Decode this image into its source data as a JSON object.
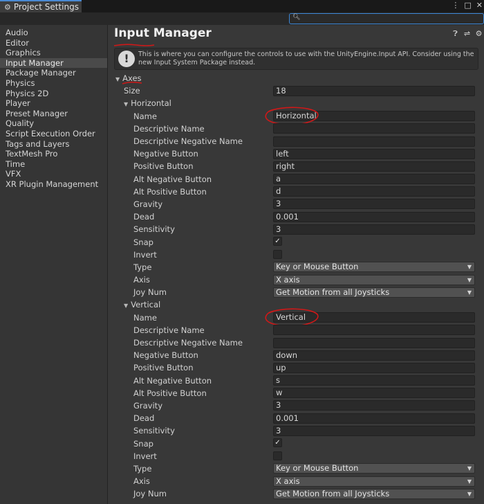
{
  "window": {
    "tab_label": "Project Settings",
    "tab_icon": "gear-icon",
    "accent": "#3b86d6"
  },
  "sidebar": {
    "items": [
      {
        "label": "Audio"
      },
      {
        "label": "Editor"
      },
      {
        "label": "Graphics"
      },
      {
        "label": "Input Manager",
        "active": true
      },
      {
        "label": "Package Manager"
      },
      {
        "label": "Physics"
      },
      {
        "label": "Physics 2D"
      },
      {
        "label": "Player"
      },
      {
        "label": "Preset Manager"
      },
      {
        "label": "Quality"
      },
      {
        "label": "Script Execution Order"
      },
      {
        "label": "Tags and Layers"
      },
      {
        "label": "TextMesh Pro"
      },
      {
        "label": "Time"
      },
      {
        "label": "VFX"
      },
      {
        "label": "XR Plugin Management"
      }
    ]
  },
  "main": {
    "title": "Input Manager",
    "help_text": "This is where you can configure the controls to use with the UnityEngine.Input API. Consider using the new Input System Package instead.",
    "axes_label": "Axes",
    "size_label": "Size",
    "size_value": "18",
    "axes": [
      {
        "name_header": "Horizontal",
        "fields": {
          "name": "Horizontal",
          "descriptive_name": "",
          "descriptive_negative_name": "",
          "negative_button": "left",
          "positive_button": "right",
          "alt_negative_button": "a",
          "alt_positive_button": "d",
          "gravity": "3",
          "dead": "0.001",
          "sensitivity": "3",
          "snap": true,
          "invert": false,
          "type": "Key or Mouse Button",
          "axis": "X axis",
          "joy_num": "Get Motion from all Joysticks"
        }
      },
      {
        "name_header": "Vertical",
        "fields": {
          "name": "Vertical",
          "descriptive_name": "",
          "descriptive_negative_name": "",
          "negative_button": "down",
          "positive_button": "up",
          "alt_negative_button": "s",
          "alt_positive_button": "w",
          "gravity": "3",
          "dead": "0.001",
          "sensitivity": "3",
          "snap": true,
          "invert": false,
          "type": "Key or Mouse Button",
          "axis": "X axis",
          "joy_num": "Get Motion from all Joysticks"
        }
      }
    ],
    "field_labels": {
      "name": "Name",
      "descriptive_name": "Descriptive Name",
      "descriptive_negative_name": "Descriptive Negative Name",
      "negative_button": "Negative Button",
      "positive_button": "Positive Button",
      "alt_negative_button": "Alt Negative Button",
      "alt_positive_button": "Alt Positive Button",
      "gravity": "Gravity",
      "dead": "Dead",
      "sensitivity": "Sensitivity",
      "snap": "Snap",
      "invert": "Invert",
      "type": "Type",
      "axis": "Axis",
      "joy_num": "Joy Num"
    },
    "annotation_color": "#d01818"
  }
}
